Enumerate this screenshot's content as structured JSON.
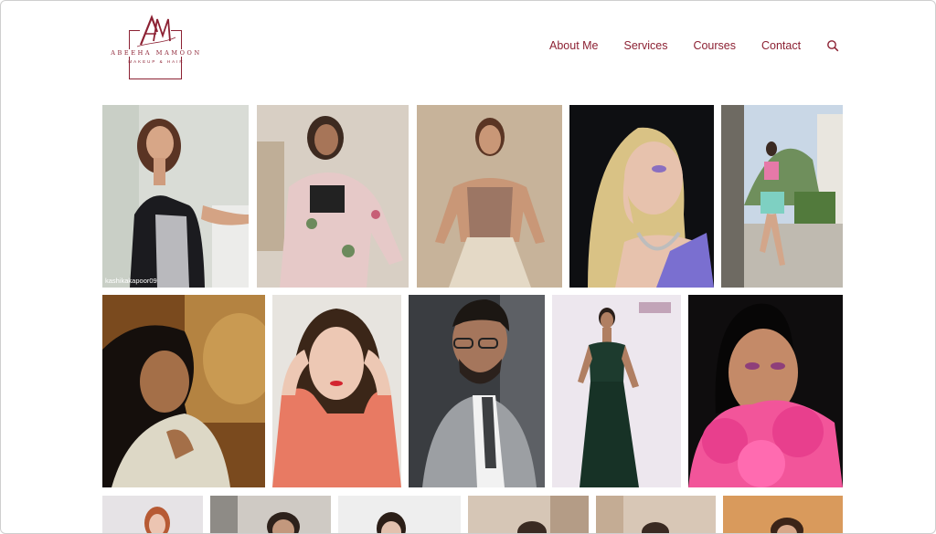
{
  "brand": {
    "monogram": "AM",
    "name": "ABEEHA MAMOON",
    "tagline": "MAKEUP & HAIR",
    "color": "#8c2133"
  },
  "nav": {
    "items": [
      {
        "label": "About Me"
      },
      {
        "label": "Services"
      },
      {
        "label": "Courses"
      },
      {
        "label": "Contact"
      }
    ],
    "search_icon": "search-icon"
  },
  "gallery": {
    "photo_credit": "kashikakapoor09"
  }
}
